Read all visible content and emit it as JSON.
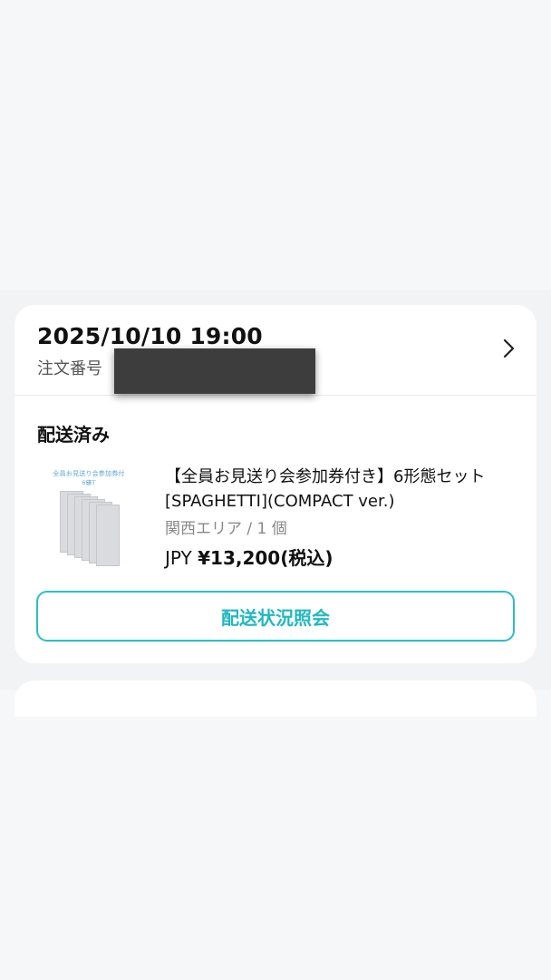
{
  "order": {
    "datetime": "2025/10/10 19:00",
    "number_label": "注文番号"
  },
  "shipment": {
    "status": "配送済み"
  },
  "product": {
    "thumbnail_title": "全員お見送り会参加券付き",
    "thumbnail_subtitle": "6SET",
    "title": "【全員お見送り会参加券付き】6形態セット [SPAGHETTI](COMPACT ver.)",
    "meta": "関西エリア / 1 個",
    "price_prefix": "JPY",
    "price_amount": "¥13,200(税込)"
  },
  "actions": {
    "track_button": "配送状況照会"
  },
  "colors": {
    "accent": "#2bbec5",
    "redaction": "#3d3d3d"
  }
}
